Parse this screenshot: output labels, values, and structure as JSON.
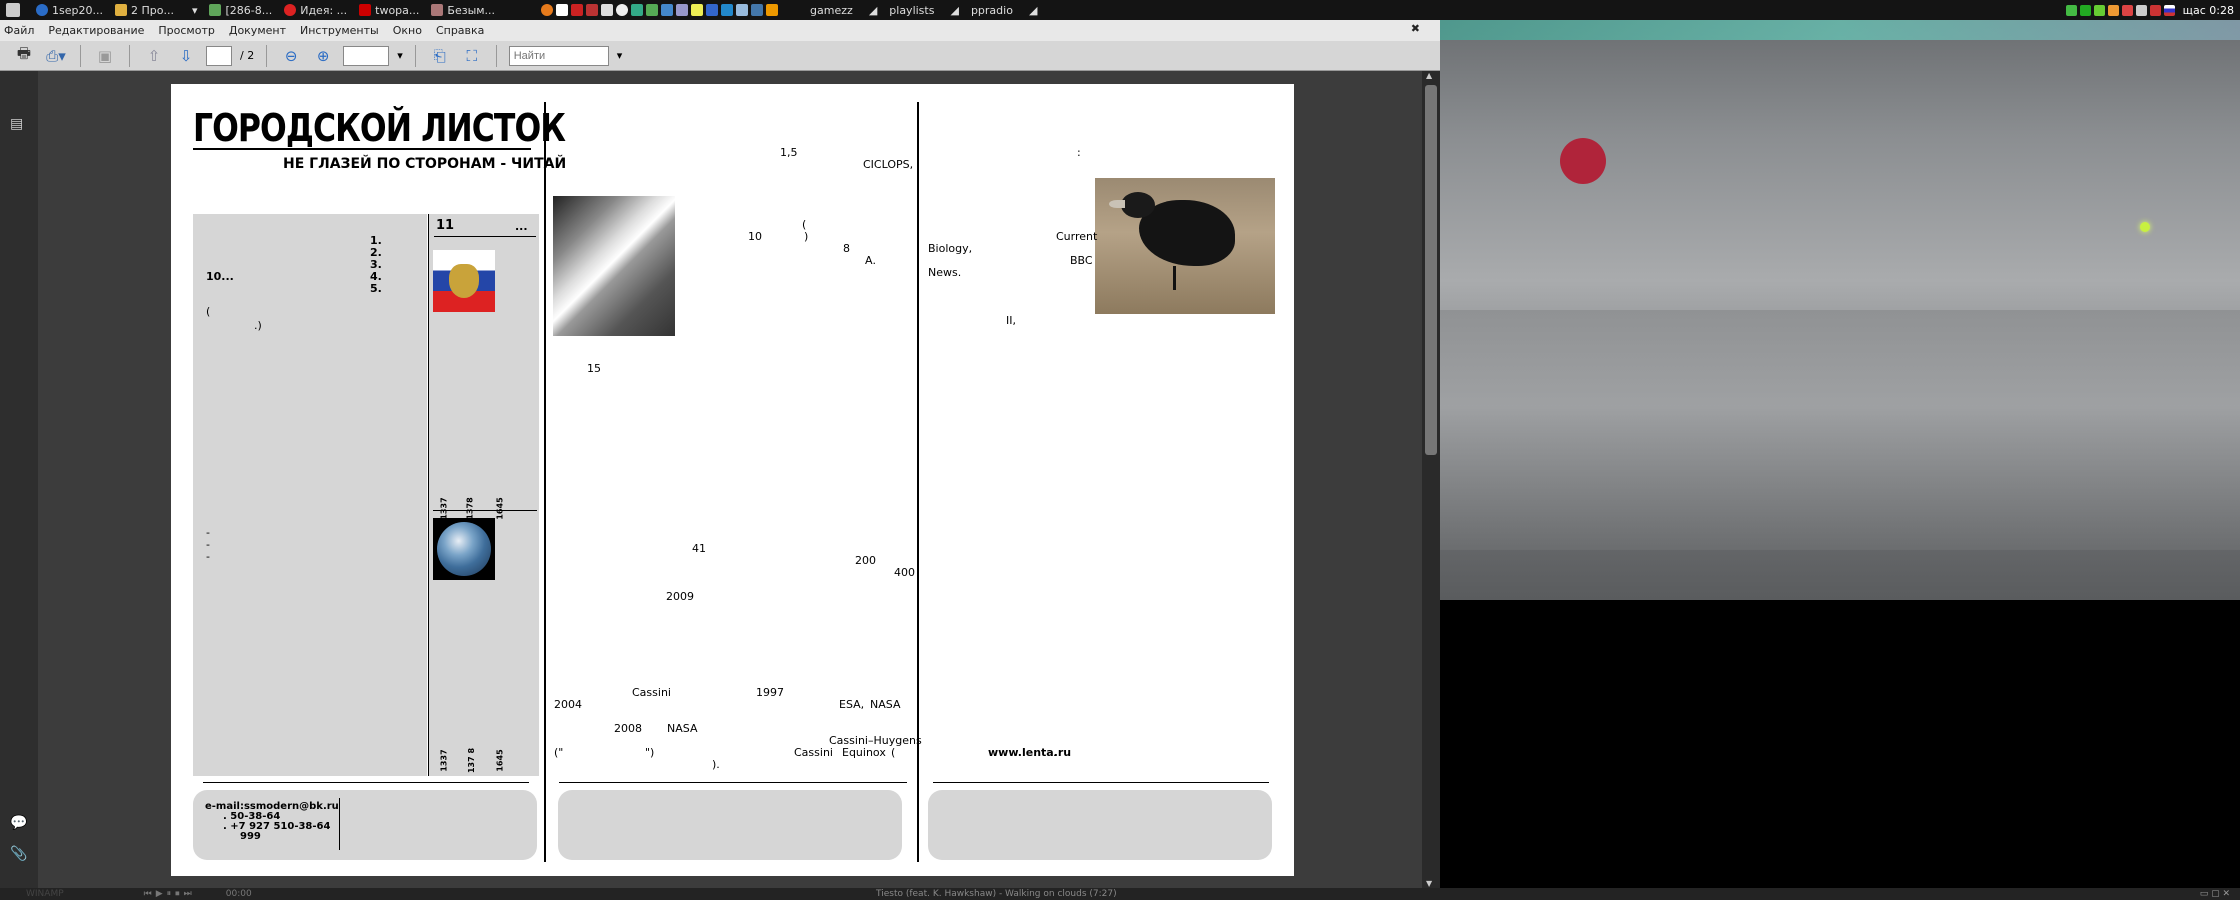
{
  "taskbar": {
    "items": [
      "1sep20...",
      "2 Про...",
      "[286-8...",
      "Идея: ...",
      "twopa...",
      "Безым..."
    ],
    "launchers": [
      "gamezz",
      "playlists",
      "ррradio"
    ],
    "clock": "щас 0:28"
  },
  "menu": [
    "Файл",
    "Редактирование",
    "Просмотр",
    "Документ",
    "Инструменты",
    "Окно",
    "Справка"
  ],
  "toolbar": {
    "page_input": "",
    "page_total": "/ 2",
    "zoom_input": "",
    "search_placeholder": "Найти"
  },
  "newspaper": {
    "masthead": "ГОРОДСКОЙ ЛИСТОК",
    "tagline": "НЕ ГЛАЗЕЙ ПО СТОРОНАМ - ЧИТАЙ",
    "col1": {
      "list": [
        "1.",
        "2.",
        "3.",
        "4.",
        "5."
      ],
      "t10": "10...",
      "paren_open": "(",
      "paren_close": ".)",
      "dashes": [
        "-",
        "-",
        "-"
      ],
      "sidebar_num": "11",
      "sidebar_ellipsis": "...",
      "years_top": [
        "1337",
        "1378",
        "1645"
      ],
      "years_bottom": [
        "1337",
        "137 8",
        "1645"
      ],
      "email": "e-mail:ssmodern@bk.ru",
      "phone1": ". 50-38-64",
      "phone2": ". +7 927 510-38-64",
      "code": "999"
    },
    "col2": {
      "t1": "1,5",
      "t2": "CICLOPS,",
      "t3": "(",
      "t4": ")",
      "t5": "10",
      "t6": "8",
      "t7": "А.",
      "t8": "15",
      "t9": "41",
      "t10": "200",
      "t11": "400",
      "t12": "2009",
      "cassini": "Cassini",
      "y1997": "1997",
      "y2004": "2004",
      "esa": "ESA,",
      "nasa1": "NASA",
      "y2008": "2008",
      "nasa2": "NASA",
      "ch": "Cassini–Huygens",
      "q1": "(\"",
      "q2": "\")",
      "ce": "Cassini",
      "eq": "Equinox",
      "p1": "(",
      "end": ")."
    },
    "col3": {
      "colon": ":",
      "current": "Current",
      "biology": "Biology,",
      "bbc": "BBC",
      "news": "News.",
      "ii": "II,",
      "source": "www.lenta.ru",
      "dot": "."
    }
  },
  "winamp": {
    "title": "WINAMP",
    "time": "00:00",
    "track": "Tiesto (feat. K. Hawkshaw) - Walking on clouds (7:27)"
  },
  "colors": {
    "paper": "#ffffff",
    "panel": "#d6d6d6",
    "reader_bg": "#3c3c3c"
  }
}
